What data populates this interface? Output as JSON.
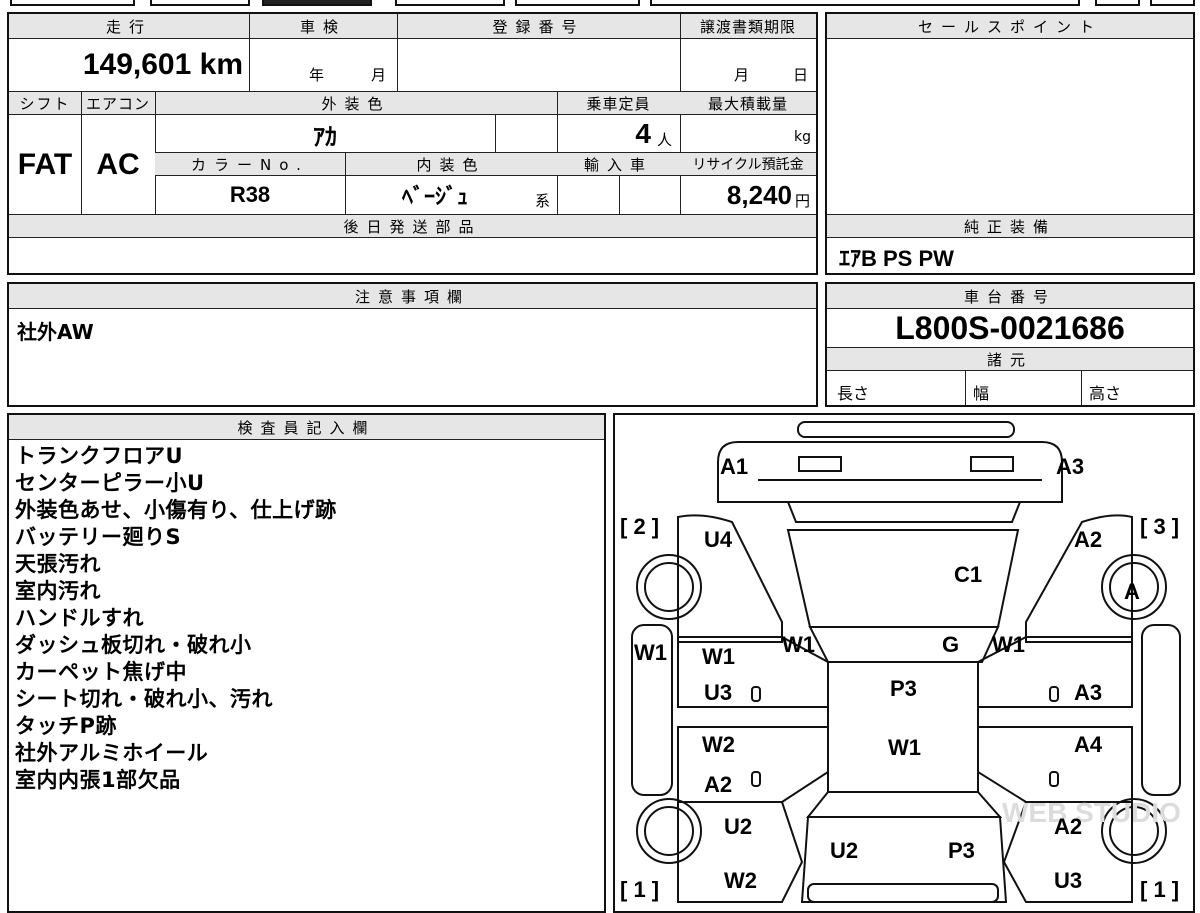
{
  "header": {
    "mileage_label": "走行",
    "shaken_label": "車検",
    "registration_label": "登録番号",
    "transfer_deadline_label": "譲渡書類期限",
    "sales_point_label": "セールスポイント",
    "shift_label": "シフト",
    "aircon_label": "エアコン",
    "exterior_color_label": "外装色",
    "capacity_label": "乗車定員",
    "max_load_label": "最大積載量",
    "color_no_label": "カラーNo.",
    "interior_color_label": "内装色",
    "import_label": "輸入車",
    "recycle_label": "リサイクル預託金",
    "later_parts_label": "後日発送部品",
    "genuine_equipment_label": "純正装備",
    "caution_label": "注意事項欄",
    "chassis_label": "車台番号",
    "specs_label": "諸元",
    "inspector_label": "検査員記入欄"
  },
  "vehicle": {
    "mileage": "149,601 km",
    "shaken_year_unit": "年",
    "shaken_month_unit": "月",
    "deadline_month_unit": "月",
    "deadline_day_unit": "日",
    "shift": "FAT",
    "aircon": "AC",
    "exterior_color": "ｱｶ",
    "capacity": "4",
    "capacity_unit": "人",
    "load_unit": "kg",
    "color_no": "R38",
    "interior_color": "ﾍﾞｰｼﾞｭ",
    "interior_suffix": "系",
    "recycle_fee": "8,240",
    "recycle_unit": "円",
    "genuine_equipment": "ｴｱB PS PW",
    "caution_note": "社外AW",
    "chassis_number": "L800S-0021686",
    "length_label": "長さ",
    "width_label": "幅",
    "height_label": "高さ"
  },
  "inspector_notes": [
    "トランクフロアU",
    "センターピラー小U",
    "外装色あせ、小傷有り、仕上げ跡",
    "バッテリー廻りS",
    "天張汚れ",
    "室内汚れ",
    "ハンドルすれ",
    "ダッシュ板切れ・破れ小",
    "カーペット焦げ中",
    "シート切れ・破れ小、汚れ",
    "タッチP跡",
    "社外アルミホイール",
    "室内内張1部欠品"
  ],
  "diagram": {
    "watermark": "WEB STUDIO",
    "labels": [
      {
        "id": "a1-rear-left",
        "text": "A1"
      },
      {
        "id": "a3-rear-right",
        "text": "A3"
      },
      {
        "id": "corner-2",
        "text": "[ 2 ]"
      },
      {
        "id": "corner-3",
        "text": "[ 3 ]"
      },
      {
        "id": "u4",
        "text": "U4"
      },
      {
        "id": "a2-top-right",
        "text": "A2"
      },
      {
        "id": "c1",
        "text": "C1"
      },
      {
        "id": "a-wheel",
        "text": "A"
      },
      {
        "id": "w1-left-side",
        "text": "W1"
      },
      {
        "id": "w1-pillar-left",
        "text": "W1"
      },
      {
        "id": "g",
        "text": "G"
      },
      {
        "id": "w1-pillar-right",
        "text": "W1"
      },
      {
        "id": "w1-door-left",
        "text": "W1"
      },
      {
        "id": "u3-door-left",
        "text": "U3"
      },
      {
        "id": "p3-roof",
        "text": "P3"
      },
      {
        "id": "a3-door-right",
        "text": "A3"
      },
      {
        "id": "w2-front-door-left",
        "text": "W2"
      },
      {
        "id": "w1-roof",
        "text": "W1"
      },
      {
        "id": "a4",
        "text": "A4"
      },
      {
        "id": "a2-front-door-left",
        "text": "A2"
      },
      {
        "id": "u2-front-left",
        "text": "U2"
      },
      {
        "id": "a2-front-right",
        "text": "A2"
      },
      {
        "id": "u2-hood",
        "text": "U2"
      },
      {
        "id": "p3-hood",
        "text": "P3"
      },
      {
        "id": "w2-front-bottom",
        "text": "W2"
      },
      {
        "id": "u3-front-right",
        "text": "U3"
      },
      {
        "id": "corner-1-left",
        "text": "[ 1 ]"
      },
      {
        "id": "corner-1-right",
        "text": "[ 1 ]"
      }
    ]
  }
}
